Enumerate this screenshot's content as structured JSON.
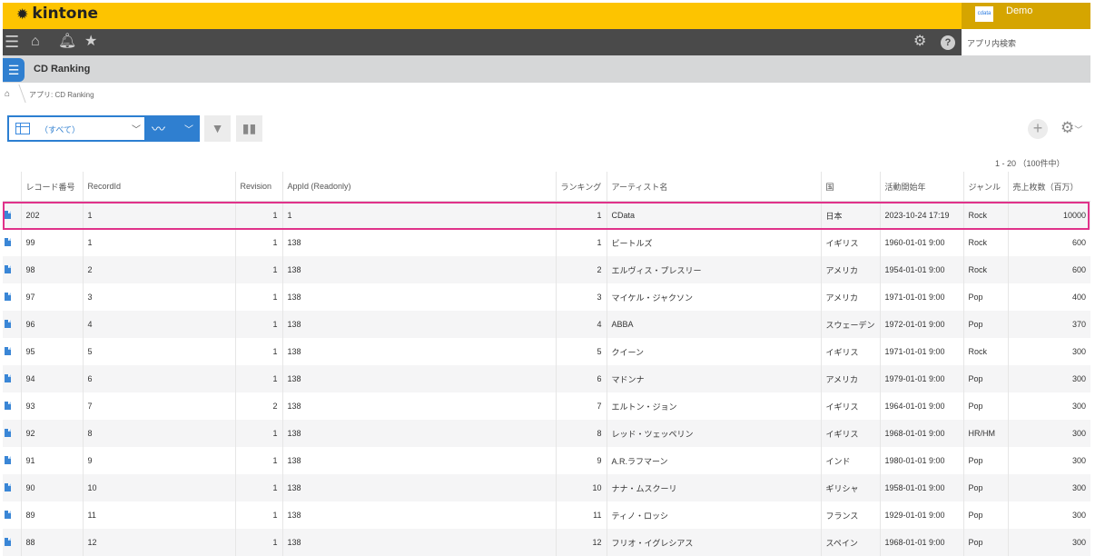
{
  "header": {
    "logo": "kintone",
    "user_name": "Demo",
    "user_badge": "cdata"
  },
  "nav": {
    "search_placeholder": "アプリ内検索"
  },
  "app": {
    "title": "CD Ranking",
    "breadcrumb": "アプリ: CD Ranking"
  },
  "toolbar": {
    "view_label": "（すべて）",
    "pager": "1 - 20 （100件中）"
  },
  "colors": {
    "header_yellow": "#fdc400",
    "nav_dark": "#4a4a4a",
    "accent_blue": "#2f7fd0",
    "highlight": "#e0328a"
  },
  "table": {
    "columns": [
      "レコード番号",
      "RecordId",
      "Revision",
      "AppId (Readonly)",
      "ランキング",
      "アーティスト名",
      "国",
      "活動開始年",
      "ジャンル",
      "売上枚数（百万）"
    ],
    "rows": [
      [
        "202",
        "1",
        "1",
        "1",
        "1",
        "CData",
        "日本",
        "2023-10-24 17:19",
        "Rock",
        "10000"
      ],
      [
        "99",
        "1",
        "1",
        "138",
        "1",
        "ビートルズ",
        "イギリス",
        "1960-01-01 9:00",
        "Rock",
        "600"
      ],
      [
        "98",
        "2",
        "1",
        "138",
        "2",
        "エルヴィス・プレスリー",
        "アメリカ",
        "1954-01-01 9:00",
        "Rock",
        "600"
      ],
      [
        "97",
        "3",
        "1",
        "138",
        "3",
        "マイケル・ジャクソン",
        "アメリカ",
        "1971-01-01 9:00",
        "Pop",
        "400"
      ],
      [
        "96",
        "4",
        "1",
        "138",
        "4",
        "ABBA",
        "スウェーデン",
        "1972-01-01 9:00",
        "Pop",
        "370"
      ],
      [
        "95",
        "5",
        "1",
        "138",
        "5",
        "クイーン",
        "イギリス",
        "1971-01-01 9:00",
        "Rock",
        "300"
      ],
      [
        "94",
        "6",
        "1",
        "138",
        "6",
        "マドンナ",
        "アメリカ",
        "1979-01-01 9:00",
        "Pop",
        "300"
      ],
      [
        "93",
        "7",
        "2",
        "138",
        "7",
        "エルトン・ジョン",
        "イギリス",
        "1964-01-01 9:00",
        "Pop",
        "300"
      ],
      [
        "92",
        "8",
        "1",
        "138",
        "8",
        "レッド・ツェッペリン",
        "イギリス",
        "1968-01-01 9:00",
        "HR/HM",
        "300"
      ],
      [
        "91",
        "9",
        "1",
        "138",
        "9",
        "A.R.ラフマーン",
        "インド",
        "1980-01-01 9:00",
        "Pop",
        "300"
      ],
      [
        "90",
        "10",
        "1",
        "138",
        "10",
        "ナナ・ムスクーリ",
        "ギリシャ",
        "1958-01-01 9:00",
        "Pop",
        "300"
      ],
      [
        "89",
        "11",
        "1",
        "138",
        "11",
        "ティノ・ロッシ",
        "フランス",
        "1929-01-01 9:00",
        "Pop",
        "300"
      ],
      [
        "88",
        "12",
        "1",
        "138",
        "12",
        "フリオ・イグレシアス",
        "スペイン",
        "1968-01-01 9:00",
        "Pop",
        "300"
      ]
    ]
  }
}
